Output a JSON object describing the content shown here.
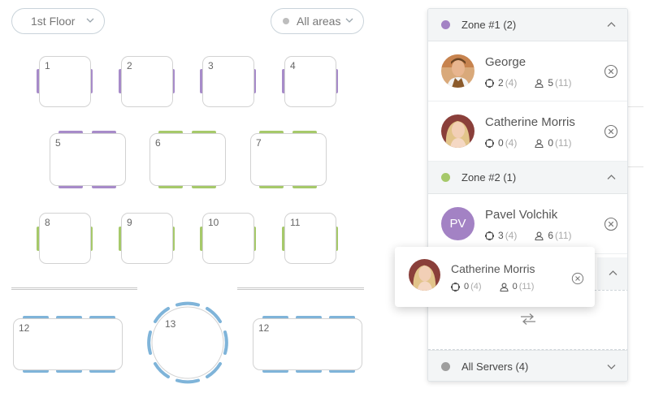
{
  "floor_select": {
    "label": "1st Floor",
    "icon": "chevron-down-icon"
  },
  "area_select": {
    "label": "All areas",
    "icon": "chevron-down-icon",
    "dot_color": "#bdbdbd"
  },
  "tables": [
    {
      "label": "1",
      "color": "#a78bc9"
    },
    {
      "label": "2",
      "color": "#a78bc9"
    },
    {
      "label": "3",
      "color": "#a78bc9"
    },
    {
      "label": "4",
      "color": "#a78bc9"
    },
    {
      "label": "5",
      "color": "#a78bc9"
    },
    {
      "label": "6",
      "color": "#a6c96a"
    },
    {
      "label": "7",
      "color": "#a6c96a"
    },
    {
      "label": "8",
      "color": "#a6c96a"
    },
    {
      "label": "9",
      "color": "#a6c96a"
    },
    {
      "label": "10",
      "color": "#a6c96a"
    },
    {
      "label": "11",
      "color": "#a6c96a"
    },
    {
      "label": "12",
      "color": "#7fb4d9"
    },
    {
      "label": "13",
      "color": "#7fb4d9"
    },
    {
      "label": "12",
      "color": "#7fb4d9"
    }
  ],
  "zones": [
    {
      "label": "Zone #1 (2)",
      "color": "#a382c4",
      "servers": [
        {
          "name": "George",
          "tables": "2",
          "tables_cap": "(4)",
          "guests": "5",
          "guests_cap": "(11)"
        },
        {
          "name": "Catherine Morris",
          "tables": "0",
          "tables_cap": "(4)",
          "guests": "0",
          "guests_cap": "(11)"
        }
      ]
    },
    {
      "label": "Zone #2 (1)",
      "color": "#a6c96a",
      "servers": [
        {
          "name": "Pavel Volchik",
          "initials": "PV",
          "tables": "3",
          "tables_cap": "(4)",
          "guests": "6",
          "guests_cap": "(11)"
        }
      ]
    }
  ],
  "all_servers": {
    "label": "All Servers (4)",
    "color": "#9e9e9e"
  },
  "dragged_server": {
    "name": "Catherine Morris",
    "tables": "0",
    "tables_cap": "(4)",
    "guests": "0",
    "guests_cap": "(11)"
  }
}
